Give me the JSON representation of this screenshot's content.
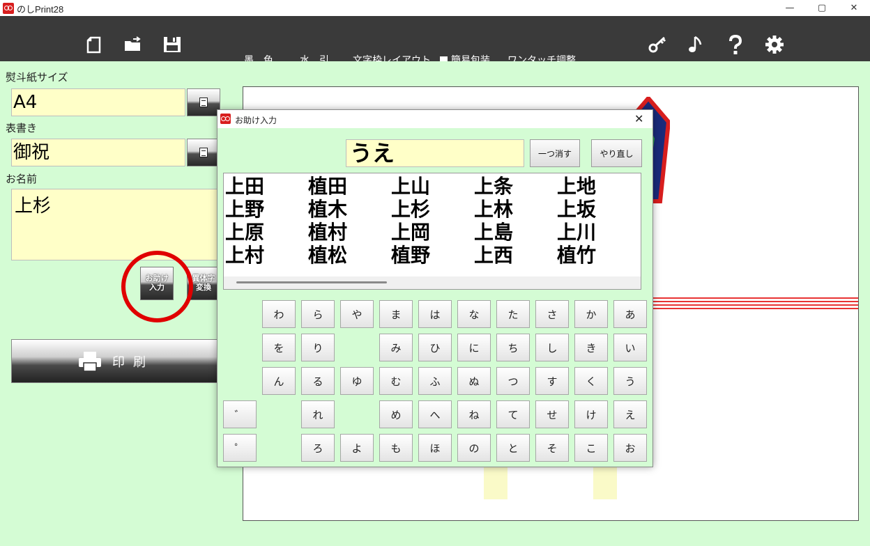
{
  "app": {
    "title": "のしPrint28"
  },
  "toolbar": {
    "menus": [
      "墨　色",
      "水　引",
      "文字枠レイアウト",
      "簡易包装",
      "ワンタッチ調整"
    ],
    "icons": [
      "new-document-icon",
      "open-folder-icon",
      "save-icon",
      "key-icon",
      "music-note-icon",
      "help-icon",
      "gear-icon"
    ]
  },
  "left_panel": {
    "size_label": "熨斗紙サイズ",
    "size_value": "A4",
    "omote_label": "表書き",
    "omote_value": "御祝",
    "name_label": "お名前",
    "name_value": "上杉",
    "helper_btn": {
      "line1": "お助け",
      "line2": "入力"
    },
    "kanji_btn": {
      "line1": "異体字",
      "line2": "変換"
    },
    "print_label": "印刷"
  },
  "dialog": {
    "title": "お助け入力",
    "input_value": "うえ",
    "undo_one_label": "一つ消す",
    "redo_label": "やり直し",
    "candidates": [
      "上田",
      "植田",
      "上山",
      "上条",
      "上地",
      "上野",
      "植木",
      "上杉",
      "上林",
      "上坂",
      "上原",
      "植村",
      "上岡",
      "上島",
      "上川",
      "上村",
      "植松",
      "植野",
      "上西",
      "植竹"
    ],
    "kana_columns": [
      [
        "わ",
        "を",
        "ん",
        "",
        ""
      ],
      [
        "ら",
        "り",
        "る",
        "れ",
        "ろ"
      ],
      [
        "や",
        "",
        "ゆ",
        "",
        "よ"
      ],
      [
        "ま",
        "み",
        "む",
        "め",
        "も"
      ],
      [
        "は",
        "ひ",
        "ふ",
        "へ",
        "ほ"
      ],
      [
        "な",
        "に",
        "ぬ",
        "ね",
        "の"
      ],
      [
        "た",
        "ち",
        "つ",
        "て",
        "と"
      ],
      [
        "さ",
        "し",
        "す",
        "せ",
        "そ"
      ],
      [
        "か",
        "き",
        "く",
        "け",
        "こ"
      ],
      [
        "あ",
        "い",
        "う",
        "え",
        "お"
      ]
    ],
    "dakuten_label": "゛",
    "handakuten_label": "゜"
  },
  "colors": {
    "panel_bg": "#d4fcd4",
    "field_bg": "#ffffc8",
    "toolbar_bg": "#3a3a3a",
    "highlight_circle": "#e00000"
  }
}
